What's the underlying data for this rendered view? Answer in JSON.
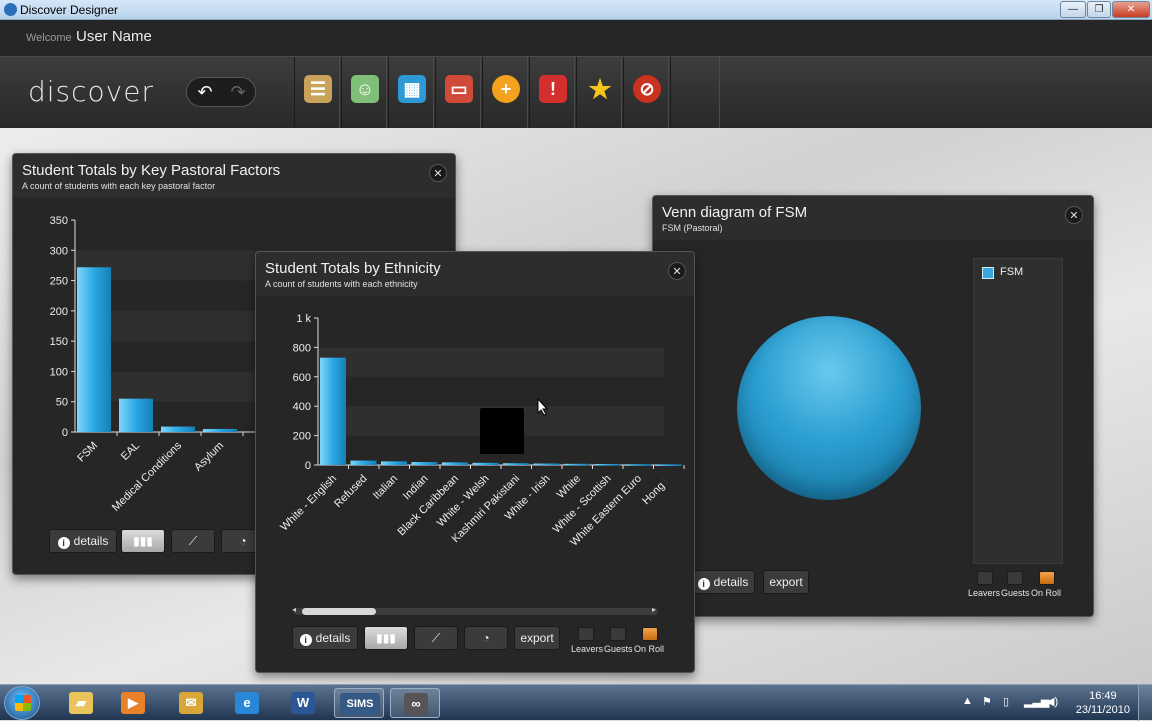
{
  "window": {
    "title": "Discover Designer",
    "controls": [
      "—",
      "❐",
      "✕"
    ]
  },
  "header": {
    "welcome": "Welcome",
    "user_name": "User Name",
    "logo": "discover",
    "nav": {
      "back": "↶",
      "forward": "↷"
    },
    "toolbar_buttons": [
      {
        "name": "student-records-icon",
        "glyph": "☰",
        "color": "#c9a35a"
      },
      {
        "name": "staff-records-icon",
        "glyph": "☺",
        "color": "#7fbf7a"
      },
      {
        "name": "structure-icon",
        "glyph": "▦",
        "color": "#2d9ad6"
      },
      {
        "name": "calendar-icon",
        "glyph": "▭",
        "color": "#d04a3a"
      },
      {
        "name": "add-icon",
        "glyph": "+",
        "color": "#f2a21c"
      },
      {
        "name": "alert-icon",
        "glyph": "!",
        "color": "#d32f2f"
      },
      {
        "name": "favourite-icon",
        "glyph": "★",
        "color": "#f5c518"
      },
      {
        "name": "block-icon",
        "glyph": "⊘",
        "color": "#c8321f"
      }
    ]
  },
  "panels": {
    "pastoral": {
      "title": "Student Totals by Key Pastoral Factors",
      "subtitle": "A count of students with each key pastoral factor",
      "close": "✕",
      "details_label": "details",
      "info_glyph": "i"
    },
    "ethnicity": {
      "title": "Student Totals by Ethnicity",
      "subtitle": "A count of students with each ethnicity",
      "close": "✕",
      "details_label": "details",
      "export_label": "export",
      "info_glyph": "i",
      "filters": [
        "Leavers",
        "Guests",
        "On Roll"
      ]
    },
    "venn": {
      "title": "Venn diagram of FSM",
      "subtitle": "FSM (Pastoral)",
      "close": "✕",
      "legend_item": "FSM",
      "details_label": "details",
      "export_label": "export",
      "info_glyph": "i",
      "filters": [
        "Leavers",
        "Guests",
        "On Roll"
      ]
    }
  },
  "taskbar": {
    "items": [
      {
        "name": "explorer-icon",
        "glyph": "▰",
        "color": "#e9c45a"
      },
      {
        "name": "media-player-icon",
        "glyph": "▶",
        "color": "#e8812a"
      },
      {
        "name": "outlook-icon",
        "glyph": "✉",
        "color": "#d9a63a"
      },
      {
        "name": "internet-explorer-icon",
        "glyph": "e",
        "color": "#2a86d6"
      },
      {
        "name": "word-icon",
        "glyph": "W",
        "color": "#2b5797"
      },
      {
        "name": "sims-app",
        "glyph": "SIMS",
        "color": "#355a86"
      },
      {
        "name": "discover-app",
        "glyph": "∞",
        "color": "#555"
      }
    ],
    "time": "16:49",
    "date": "23/11/2010"
  },
  "chart_data": [
    {
      "type": "bar",
      "title": "Student Totals by Key Pastoral Factors",
      "subtitle": "A count of students with each key pastoral factor",
      "categories": [
        "FSM",
        "EAL",
        "Medical Conditions",
        "Asylum"
      ],
      "values": [
        272,
        55,
        9,
        5
      ],
      "ylim": [
        0,
        350
      ],
      "yticks": [
        "0",
        "50",
        "100",
        "150",
        "200",
        "250",
        "300",
        "350"
      ],
      "grid": true
    },
    {
      "type": "bar",
      "title": "Student Totals by Ethnicity",
      "subtitle": "A count of students with each ethnicity",
      "categories": [
        "White - English",
        "Refused",
        "Italian",
        "Indian",
        "Black Caribbean",
        "White - Welsh",
        "Kashmiri Pakistani",
        "White - Irish",
        "White",
        "White - Scottish",
        "White Eastern Euro",
        "Hong K"
      ],
      "values": [
        730,
        30,
        25,
        20,
        18,
        15,
        12,
        10,
        8,
        7,
        5,
        4
      ],
      "ylim": [
        0,
        1000
      ],
      "yticks": [
        "0",
        "200",
        "400",
        "600",
        "800",
        "1 k"
      ],
      "grid": true
    }
  ]
}
